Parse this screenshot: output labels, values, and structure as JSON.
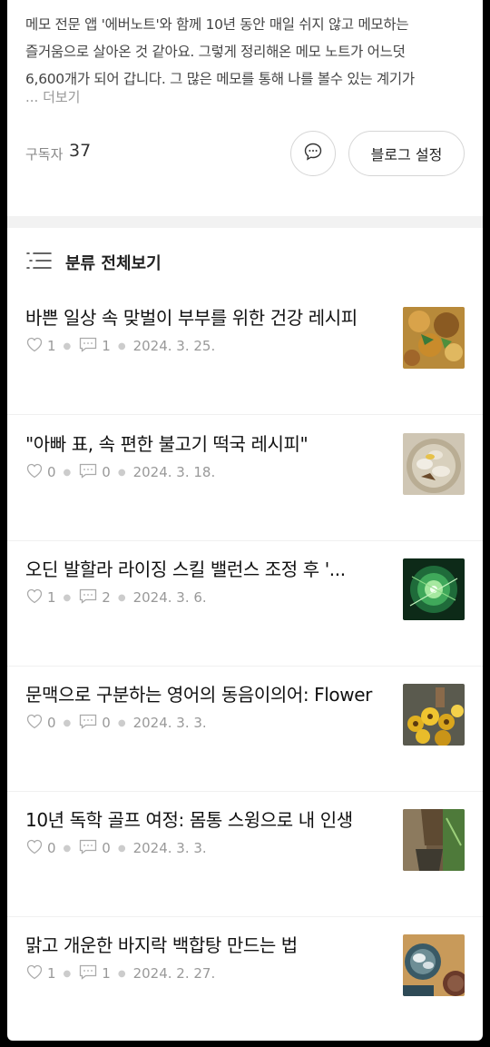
{
  "intro": {
    "lines": [
      "메모 전문 앱 '에버노트'와 함께 10년 동안 매일 쉬지 않고 메모하는",
      "즐거움으로 살아온 것 같아요. 그렇게 정리해온 메모 노트가 어느덧",
      "6,600개가 되어 갑니다. 그 많은 메모를 통해 나를 볼수 있는 계기가"
    ],
    "more_label": "... 더보기"
  },
  "subscribers": {
    "label": "구독자",
    "count": "37"
  },
  "buttons": {
    "settings_label": "블로그 설정"
  },
  "category": {
    "title": "분류 전체보기"
  },
  "posts": [
    {
      "title": "바쁜 일상 속 맞벌이 부부를 위한 건강 레시피",
      "likes": "1",
      "comments": "1",
      "date": "2024. 3. 25."
    },
    {
      "title": "\"아빠 표, 속 편한 불고기 떡국 레시피\"",
      "likes": "0",
      "comments": "0",
      "date": "2024. 3. 18."
    },
    {
      "title": "오딘 발할라 라이징 스킬 밸런스 조정 후 '...",
      "likes": "1",
      "comments": "2",
      "date": "2024. 3. 6."
    },
    {
      "title": "문맥으로 구분하는 영어의 동음이의어: Flower",
      "likes": "0",
      "comments": "0",
      "date": "2024. 3. 3."
    },
    {
      "title": "10년 독학 골프 여정: 몸통 스윙으로 내 인생",
      "likes": "0",
      "comments": "0",
      "date": "2024. 3. 3."
    },
    {
      "title": "맑고 개운한 바지락 백합탕 만드는 법",
      "likes": "1",
      "comments": "1",
      "date": "2024. 2. 27."
    }
  ]
}
